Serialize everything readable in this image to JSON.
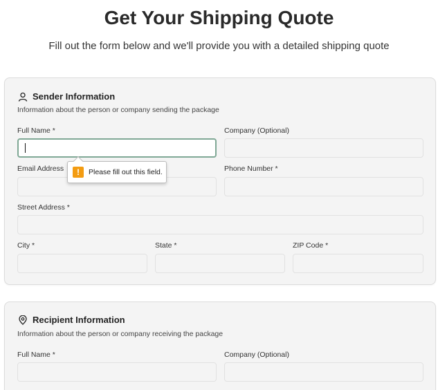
{
  "header": {
    "title": "Get Your Shipping Quote",
    "subtitle": "Fill out the form below and we'll provide you with a detailed shipping quote"
  },
  "sender": {
    "title": "Sender Information",
    "icon": "user-icon",
    "description": "Information about the person or company sending the package",
    "fields": {
      "full_name": "Full Name *",
      "company": "Company (Optional)",
      "email": "Email Address",
      "phone": "Phone Number *",
      "street": "Street Address *",
      "city": "City *",
      "state": "State *",
      "zip": "ZIP Code *"
    }
  },
  "validation": {
    "message": "Please fill out this field.",
    "icon": "warning-icon",
    "icon_glyph": "!",
    "color": "#f39c12"
  },
  "recipient": {
    "title": "Recipient Information",
    "icon": "map-pin-icon",
    "description": "Information about the person or company receiving the package",
    "fields": {
      "full_name": "Full Name *",
      "company": "Company (Optional)"
    }
  }
}
